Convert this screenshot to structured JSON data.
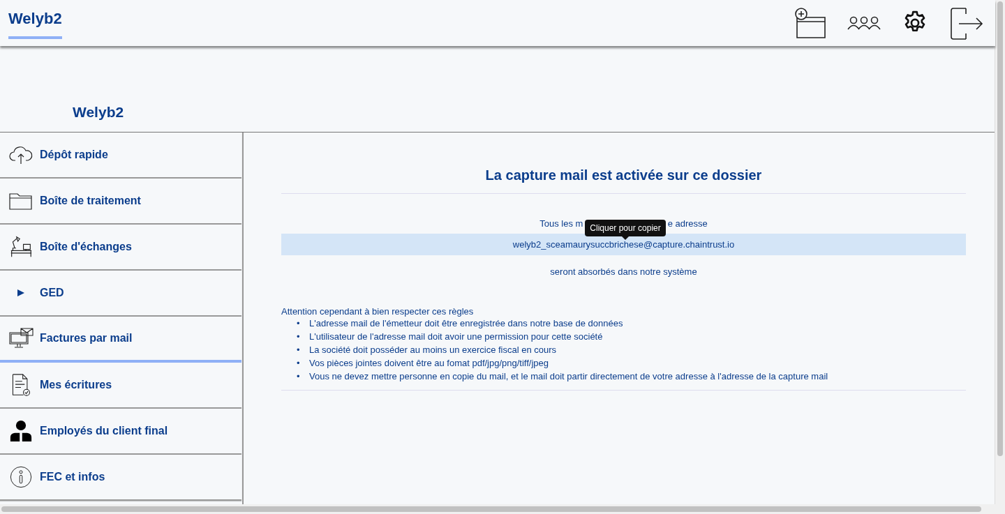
{
  "header": {
    "tabs": [
      {
        "label": "Welyb2",
        "selected": true
      }
    ]
  },
  "company": {
    "name": "Welyb2"
  },
  "sidebar": {
    "items": [
      {
        "label": "Dépôt rapide",
        "kind": "cloud",
        "selected": false
      },
      {
        "label": "Boîte de traitement",
        "kind": "folder",
        "selected": false
      },
      {
        "label": "Boîte d'échanges",
        "kind": "desk",
        "selected": false
      },
      {
        "label": "GED",
        "kind": "arrow",
        "selected": false
      },
      {
        "label": "Factures par mail",
        "kind": "mail",
        "selected": true
      },
      {
        "label": "Mes écritures",
        "kind": "doc",
        "selected": false
      },
      {
        "label": "Employés du client final",
        "kind": "person",
        "selected": false
      },
      {
        "label": "FEC et infos",
        "kind": "info",
        "selected": false
      }
    ]
  },
  "content": {
    "title": "La capture mail est activée sur ce dossier",
    "intro_start": "Tous les m",
    "intro_end": "e adresse",
    "tooltip": "Cliquer pour copier",
    "email": "welyb2_sceamaurysuccbrichese@capture.chaintrust.io",
    "outro": "seront absorbés dans notre système",
    "rules_title": "Attention cependant à bien respecter ces règles",
    "rules": [
      {
        "bullet": "•",
        "text": "L'adresse mail de l'émetteur doit être enregistrée dans notre base de données"
      },
      {
        "bullet": "•",
        "text": "L'utilisateur de l'adresse mail doit avoir une permission pour cette société"
      },
      {
        "bullet": "•",
        "text": "La société doit posséder au moins un exercice fiscal en cours"
      },
      {
        "bullet": "•",
        "text": "Vos pièces jointes doivent être au fomat pdf/jpg/png/tiff/jpeg"
      },
      {
        "bullet": "•",
        "text": "Vous ne devez mettre personne en copie du mail, et le mail doit partir directement de votre adresse à l'adresse de la capture mail"
      }
    ]
  }
}
